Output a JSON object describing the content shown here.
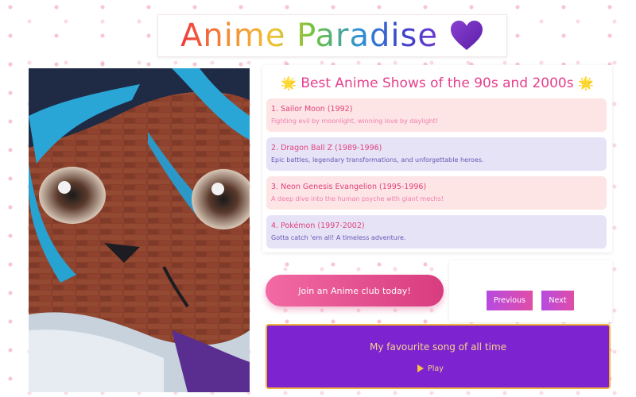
{
  "header": {
    "title": "Anime Paradise"
  },
  "mural": {
    "icon": "anime-mural-image"
  },
  "shows": {
    "heading": "Best Anime Shows of the 90s and 2000s",
    "star": "🌟",
    "items": [
      {
        "title": "1. Sailor Moon (1992)",
        "desc": "Fighting evil by moonlight, winning love by daylight!"
      },
      {
        "title": "2. Dragon Ball Z (1989-1996)",
        "desc": "Epic battles, legendary transformations, and unforgettable heroes."
      },
      {
        "title": "3. Neon Genesis Evangelion (1995-1996)",
        "desc": "A deep dive into the human psyche with giant mechs!"
      },
      {
        "title": "4. Pokémon (1997-2002)",
        "desc": "Gotta catch 'em all! A timeless adventure."
      }
    ]
  },
  "cta": {
    "join_label": "Join an Anime club today!"
  },
  "pager": {
    "prev_label": "Previous",
    "next_label": "Next"
  },
  "music": {
    "title": "My favourite song of all time",
    "play_label": "Play"
  },
  "colors": {
    "heart": "#7b2fbe",
    "pink_item": "#fde4e5",
    "lavender_item": "#e6e3f7",
    "music_bg": "#7d24d0",
    "music_border": "#f1b33a"
  }
}
